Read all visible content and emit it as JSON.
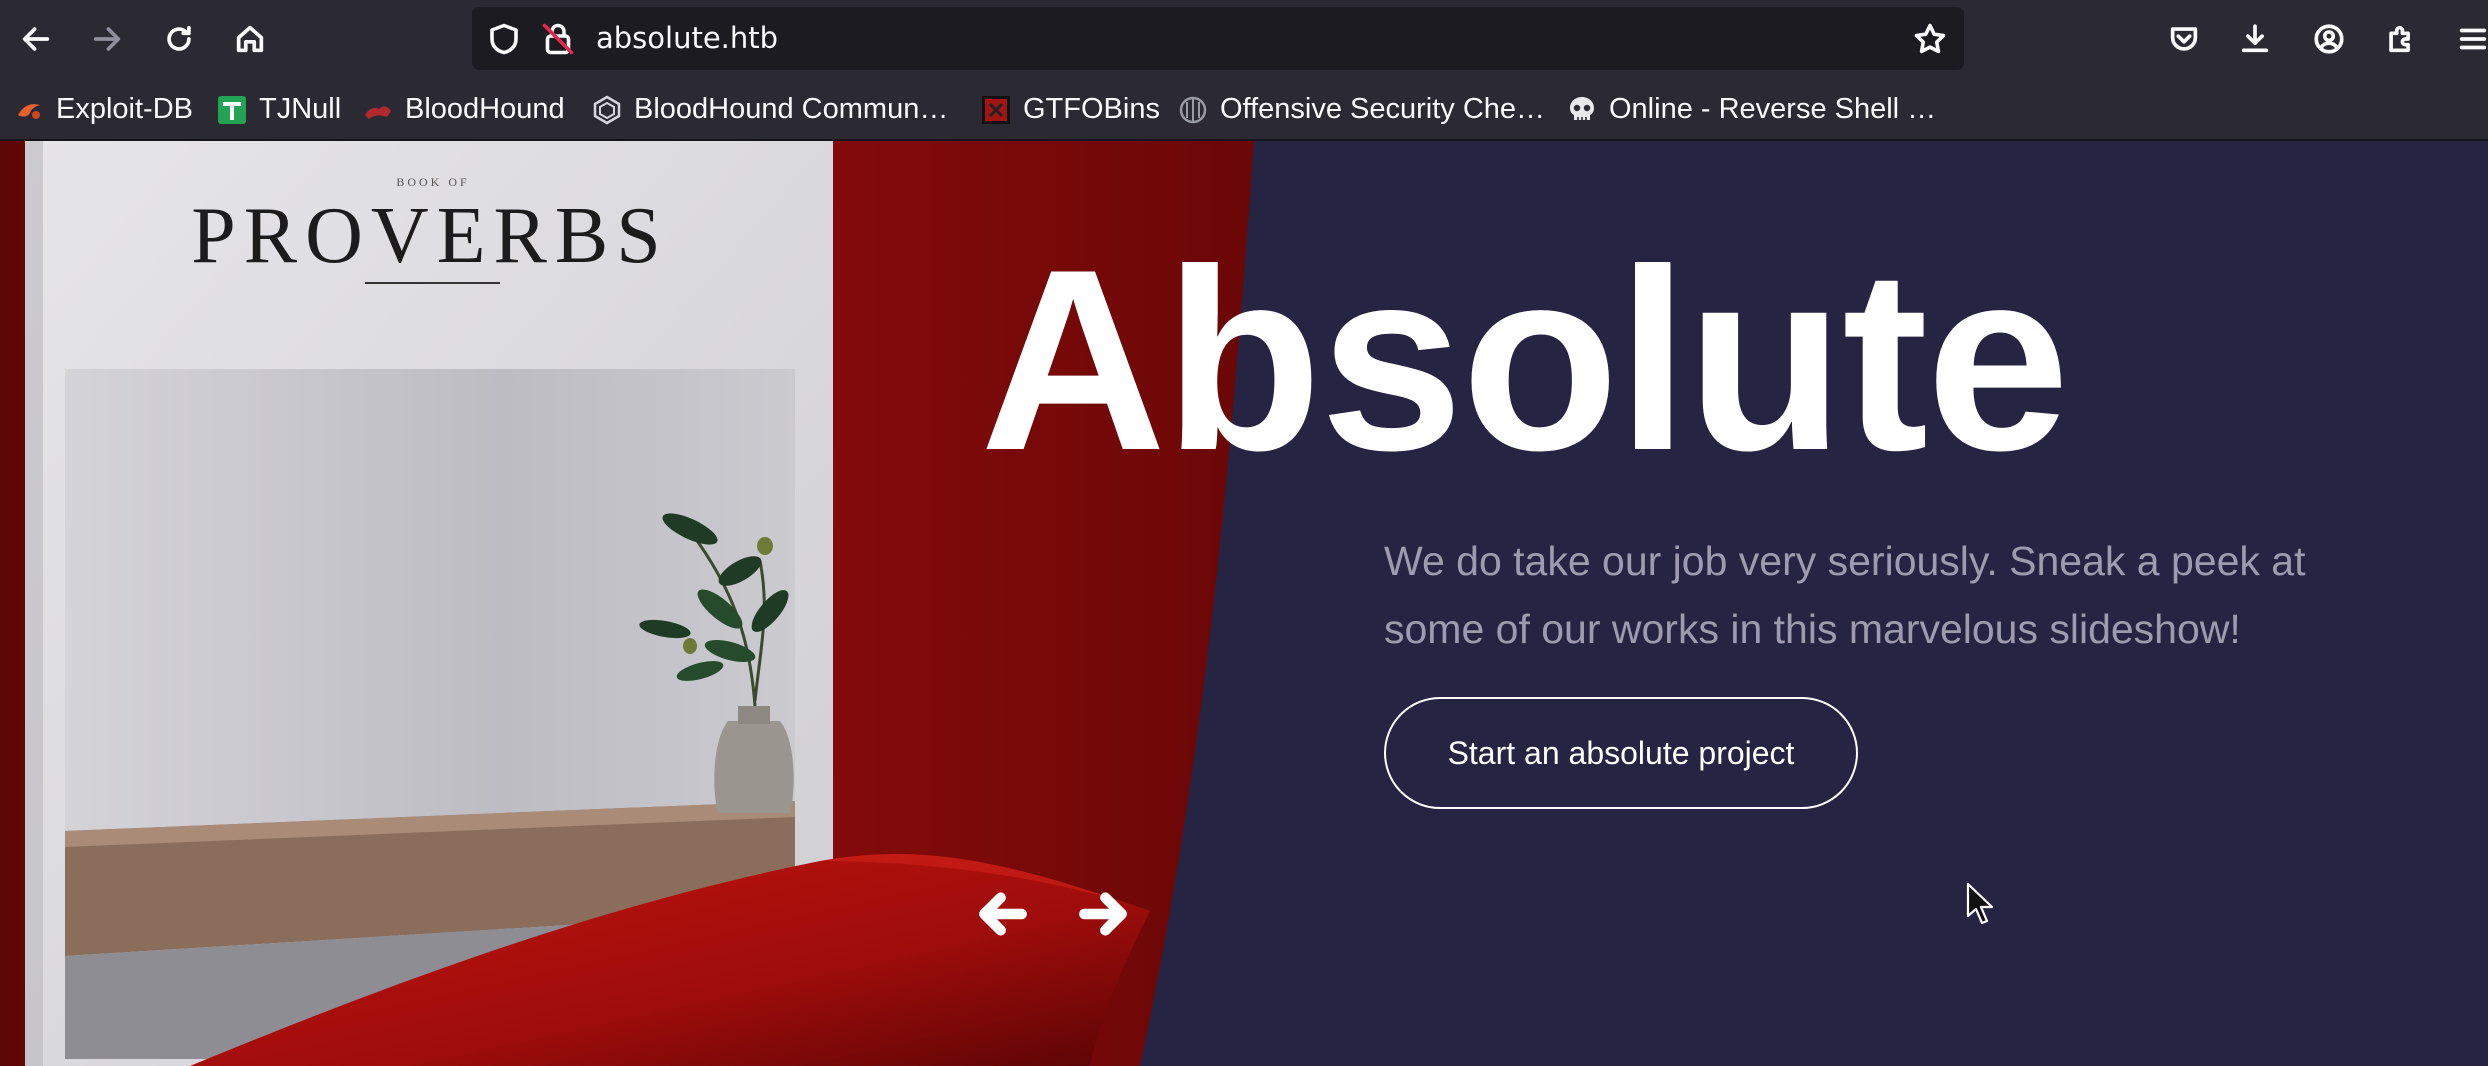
{
  "browser": {
    "url": "absolute.htb",
    "nav": [
      {
        "name": "back-icon",
        "enabled": true
      },
      {
        "name": "forward-icon",
        "enabled": false
      },
      {
        "name": "reload-icon",
        "enabled": true
      },
      {
        "name": "home-icon",
        "enabled": true
      }
    ],
    "url_bar_icons": [
      "shield-icon",
      "insecure-lock-icon",
      "bookmark-star-icon"
    ],
    "toolbar_icons": [
      "pocket-icon",
      "download-icon",
      "account-icon",
      "extensions-icon",
      "menu-icon"
    ]
  },
  "bookmarks": [
    {
      "label": "Exploit-DB",
      "icon": "exploit-db-icon"
    },
    {
      "label": "TJNull",
      "icon": "tjnull-icon"
    },
    {
      "label": "BloodHound",
      "icon": "bloodhound-icon"
    },
    {
      "label": "BloodHound Commun…",
      "icon": "bloodhound-community-icon"
    },
    {
      "label": "GTFOBins",
      "icon": "gtfobins-icon"
    },
    {
      "label": "Offensive Security Che…",
      "icon": "offsec-cheatsheet-icon"
    },
    {
      "label": "Online - Reverse Shell …",
      "icon": "skull-icon"
    }
  ],
  "hero": {
    "title": "Absolute",
    "text": "We do take our job very seriously. Sneak a peek at some of our works in this marvelous slideshow!",
    "cta": "Start an absolute project"
  },
  "slide_photo": {
    "book_small_caption": "BOOK OF",
    "book_title": "PROVERBS"
  },
  "colors": {
    "chrome_bg": "#2b2a33",
    "url_bar_bg": "#1c1b22",
    "page_bg": "#262443",
    "accent_red": "#8a0b0b"
  }
}
